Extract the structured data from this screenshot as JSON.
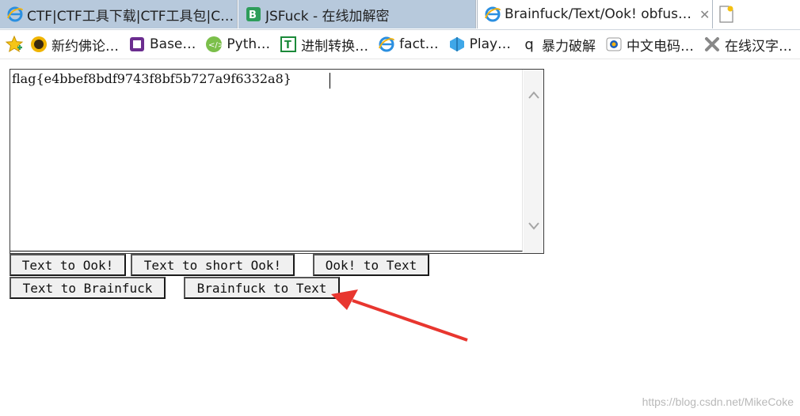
{
  "tabs": [
    {
      "title": "CTF|CTF工具下载|CTF工具包|C…",
      "icon": "ie-icon",
      "active": false
    },
    {
      "title": "JSFuck - 在线加解密",
      "icon": "js-icon",
      "active": false
    },
    {
      "title": "Brainfuck/Text/Ook! obfus…",
      "icon": "ie-icon",
      "active": true
    }
  ],
  "favorites": [
    {
      "label": "新约佛论…",
      "icon": "buddha-icon"
    },
    {
      "label": "Base…",
      "icon": "base-icon"
    },
    {
      "label": "Pyth…",
      "icon": "python-icon"
    },
    {
      "label": "进制转换…",
      "icon": "convert-icon"
    },
    {
      "label": "fact…",
      "icon": "ie-icon"
    },
    {
      "label": "Play…",
      "icon": "play-icon"
    },
    {
      "label": "暴力破解",
      "icon": "q-icon"
    },
    {
      "label": "中文电码…",
      "icon": "code-icon"
    },
    {
      "label": "在线汉字…",
      "icon": "joomla-icon"
    }
  ],
  "editor": {
    "value": "flag{e4bbef8bdf9743f8bf5b727a9f6332a8}"
  },
  "buttons": {
    "text_to_ook": "Text to Ook!",
    "text_to_short_ook": "Text to short Ook!",
    "ook_to_text": "Ook! to Text",
    "text_to_brainfuck": "Text to Brainfuck",
    "brainfuck_to_text": "Brainfuck to Text"
  },
  "annotation": {
    "arrow_color": "#e8362f"
  },
  "watermark": "https://blog.csdn.net/MikeCoke"
}
